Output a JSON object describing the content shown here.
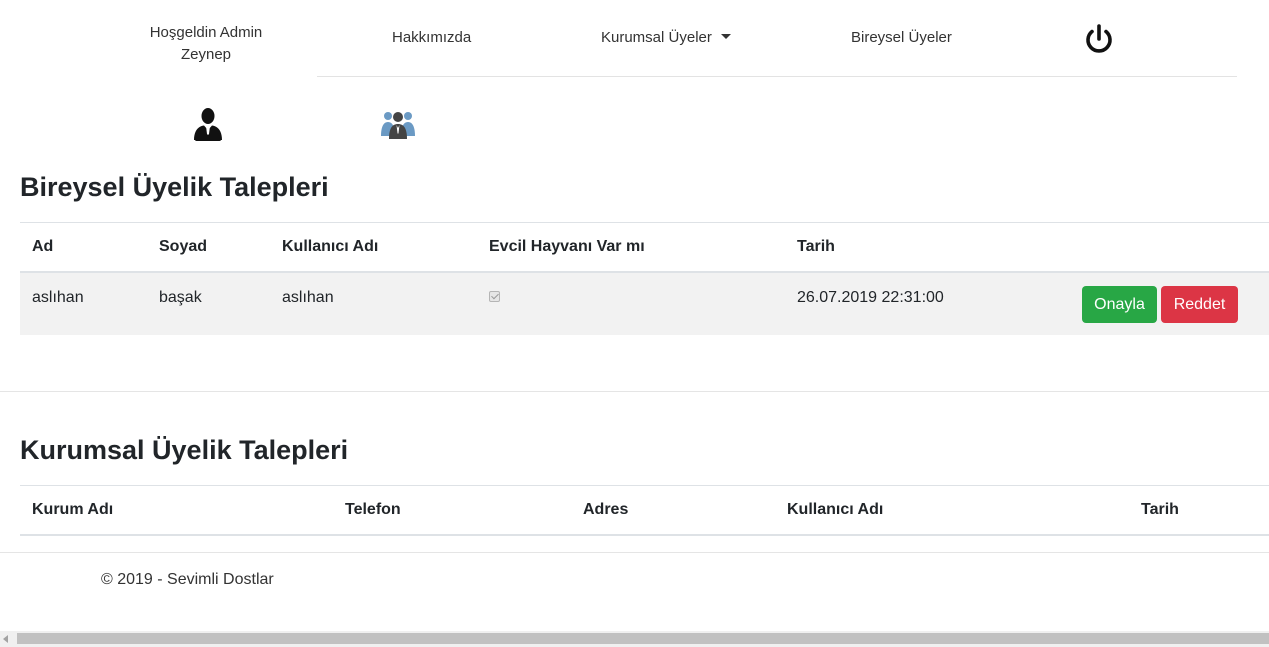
{
  "nav": {
    "welcome": "Hoşgeldin Admin Zeynep",
    "about": "Hakkımızda",
    "corporate_members": "Kurumsal Üyeler",
    "individual_members": "Bireysel Üyeler",
    "power_icon": "power-icon"
  },
  "quick_icons": {
    "user": "user-icon",
    "group": "users-group-icon"
  },
  "individual": {
    "title": "Bireysel Üyelik Talepleri",
    "columns": [
      "Ad",
      "Soyad",
      "Kullanıcı Adı",
      "Evcil Hayvanı Var mı",
      "Tarih"
    ],
    "rows": [
      {
        "ad": "aslıhan",
        "soyad": "başak",
        "kullanici_adi": "aslıhan",
        "evcil_hayvan": true,
        "tarih": "26.07.2019 22:31:00",
        "approve": "Onayla",
        "reject": "Reddet"
      }
    ]
  },
  "corporate": {
    "title": "Kurumsal Üyelik Talepleri",
    "columns": [
      "Kurum Adı",
      "Telefon",
      "Adres",
      "Kullanıcı Adı",
      "Tarih"
    ],
    "rows": []
  },
  "footer": {
    "text": "© 2019 - Sevimli Dostlar"
  },
  "colors": {
    "success": "#28a745",
    "danger": "#dc3545",
    "row_stripe": "#f2f2f2"
  }
}
